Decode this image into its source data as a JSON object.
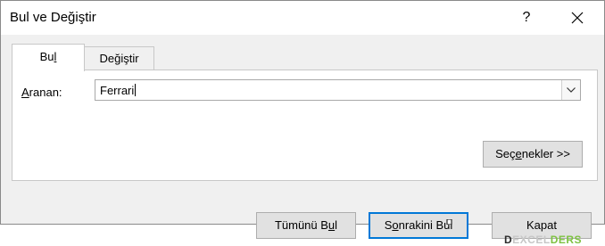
{
  "window": {
    "title": "Bul ve Değiştir",
    "help_label": "?"
  },
  "tabs": {
    "find": {
      "label_pre": "Bu",
      "label_hotkey": "l",
      "label_post": ""
    },
    "replace": {
      "label_pre": "De",
      "label_hotkey": "ğ",
      "label_post": "iştir"
    }
  },
  "find": {
    "label_pre": "",
    "label_hotkey": "A",
    "label_post": "ranan:",
    "value": "Ferrari"
  },
  "buttons": {
    "options": {
      "pre": "Seç",
      "hotkey": "e",
      "post": "nekler >>"
    },
    "find_all": {
      "pre": "Tümünü B",
      "hotkey": "u",
      "post": "l"
    },
    "find_next": {
      "pre": "S",
      "hotkey": "o",
      "post": "nrakini Bul"
    },
    "close": {
      "label": "Kapat"
    }
  },
  "watermark": {
    "part1": "D",
    "part2": "EXCEL",
    "part3": "DERS"
  },
  "colors": {
    "dialog_bg": "#f0f0f0",
    "focus_border": "#0078d7",
    "button_bg": "#e1e1e1",
    "watermark_green": "#7ec242"
  }
}
